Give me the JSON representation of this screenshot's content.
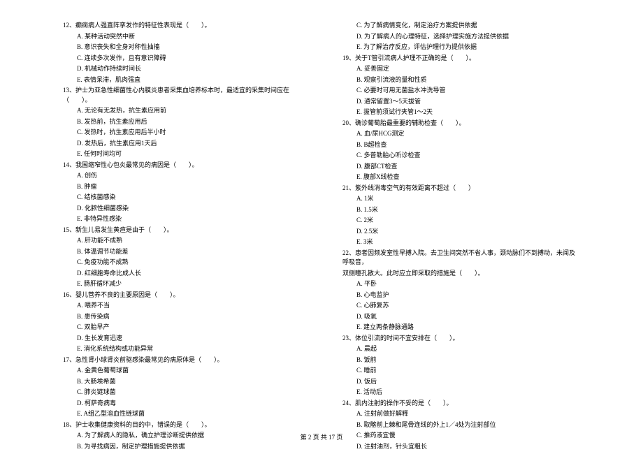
{
  "leftColumn": [
    {
      "type": "q",
      "text": "12、癫痫病人强直阵挛发作的特征性表现是（　　）。"
    },
    {
      "type": "o",
      "text": "A. 某种活动突然中断"
    },
    {
      "type": "o",
      "text": "B. 意识丧失和全身对称性抽搐"
    },
    {
      "type": "o",
      "text": "C. 连续多次发作，且有意识障碍"
    },
    {
      "type": "o",
      "text": "D. 机械动作持续时间长"
    },
    {
      "type": "o",
      "text": "E. 表情呆滞，肌肉强直"
    },
    {
      "type": "q",
      "text": "13、护士为亚急性细菌性心内膜炎患者采集血培养标本时，最适宜的采集时间应在（　　）。"
    },
    {
      "type": "o",
      "text": "A. 无论有无发热，抗生素应用前"
    },
    {
      "type": "o",
      "text": "B. 发热前，抗生素应用后"
    },
    {
      "type": "o",
      "text": "C. 发热时，抗生素应用后半小时"
    },
    {
      "type": "o",
      "text": "D. 发热后，抗生素应用1天后"
    },
    {
      "type": "o",
      "text": "E. 任何时间均可"
    },
    {
      "type": "q",
      "text": "14、我国缩窄性心包炎最常见的病因是（　　）。"
    },
    {
      "type": "o",
      "text": "A. 创伤"
    },
    {
      "type": "o",
      "text": "B. 肿瘤"
    },
    {
      "type": "o",
      "text": "C. 结核菌感染"
    },
    {
      "type": "o",
      "text": "D. 化脓性细菌感染"
    },
    {
      "type": "o",
      "text": "E. 非特异性感染"
    },
    {
      "type": "q",
      "text": "15、新生儿易发生黄疸是由于（　　）。"
    },
    {
      "type": "o",
      "text": "A. 肝功能不成熟"
    },
    {
      "type": "o",
      "text": "B. 体温调节功能差"
    },
    {
      "type": "o",
      "text": "C. 免疫功能不成熟"
    },
    {
      "type": "o",
      "text": "D. 红细胞寿命比成人长"
    },
    {
      "type": "o",
      "text": "E. 肠肝循环减少"
    },
    {
      "type": "q",
      "text": "16、婴儿营养不良的主要原因是（　　）。"
    },
    {
      "type": "o",
      "text": "A. 喂养不当"
    },
    {
      "type": "o",
      "text": "B. 患传染病"
    },
    {
      "type": "o",
      "text": "C. 双胎早产"
    },
    {
      "type": "o",
      "text": "D. 生长发育迅速"
    },
    {
      "type": "o",
      "text": "E. 消化系统结构或功能异常"
    },
    {
      "type": "q",
      "text": "17、急性肾小球肾炎前驱感染最常见的病原体是（　　）。"
    },
    {
      "type": "o",
      "text": "A. 金黄色葡萄球菌"
    },
    {
      "type": "o",
      "text": "B. 大肠埃希菌"
    },
    {
      "type": "o",
      "text": "C. 肺炎链球菌"
    },
    {
      "type": "o",
      "text": "D. 柯萨奇病毒"
    },
    {
      "type": "o",
      "text": "E. A组乙型溶血性链球菌"
    },
    {
      "type": "q",
      "text": "18、护士收集健康资料的目的中，错误的是（　　）。"
    },
    {
      "type": "o",
      "text": "A. 为了解病人的隐私，确立护理诊断提供依据"
    },
    {
      "type": "o",
      "text": "B. 为寻找病因，制定护理措施提供依据"
    }
  ],
  "rightColumn": [
    {
      "type": "o",
      "text": "C. 为了解病情变化，制定治疗方案提供依据"
    },
    {
      "type": "o",
      "text": "D. 为了解病人的心理特征，选择护理实施方法提供依据"
    },
    {
      "type": "o",
      "text": "E. 为了解治疗反应，评估护理行为提供依据"
    },
    {
      "type": "q",
      "text": "19、关于T管引流病人护理不正确的是（　　）。"
    },
    {
      "type": "o",
      "text": "A. 妥善固定"
    },
    {
      "type": "o",
      "text": "B. 观察引流液的量和性质"
    },
    {
      "type": "o",
      "text": "C. 必要时可用无菌盐水冲洗导管"
    },
    {
      "type": "o",
      "text": "D. 通常留置3～5天拔管"
    },
    {
      "type": "o",
      "text": "E. 拔管前须试行夹管1～2天"
    },
    {
      "type": "q",
      "text": "20、确诊葡萄胎最重要的辅助检查（　　）。"
    },
    {
      "type": "o",
      "text": "A. 血/尿HCG测定"
    },
    {
      "type": "o",
      "text": "B. B超检查"
    },
    {
      "type": "o",
      "text": "C. 多普勒胎心听诊检查"
    },
    {
      "type": "o",
      "text": "D. 腹部CT检查"
    },
    {
      "type": "o",
      "text": "E. 腹部X线检查"
    },
    {
      "type": "q",
      "text": "21、紫外线消毒空气的有效距离不超过（　　）"
    },
    {
      "type": "o",
      "text": "A. 1米"
    },
    {
      "type": "o",
      "text": "B. 1.5米"
    },
    {
      "type": "o",
      "text": "C. 2米"
    },
    {
      "type": "o",
      "text": "D. 2.5米"
    },
    {
      "type": "o",
      "text": "E. 3米"
    },
    {
      "type": "q",
      "text": "22、患者因频发室性早搏入院。去卫生间突然不省人事，颈动脉们不到搏动，未闻及呼吸音，"
    },
    {
      "type": "s",
      "text": "双侧瞳孔散大。此时应立即采取的措施是（　　）。"
    },
    {
      "type": "o",
      "text": "A. 平卧"
    },
    {
      "type": "o",
      "text": "B. 心电监护"
    },
    {
      "type": "o",
      "text": "C. 心肺复苏"
    },
    {
      "type": "o",
      "text": "D. 吸氧"
    },
    {
      "type": "o",
      "text": "E. 建立两条静脉通路"
    },
    {
      "type": "q",
      "text": "23、体位引流的时间不宜安排在（　　）。"
    },
    {
      "type": "o",
      "text": "A. 晨起"
    },
    {
      "type": "o",
      "text": "B. 饭前"
    },
    {
      "type": "o",
      "text": "C. 睡前"
    },
    {
      "type": "o",
      "text": "D. 饭后"
    },
    {
      "type": "o",
      "text": "E. 活动后"
    },
    {
      "type": "q",
      "text": "24、肌内注射的操作不妥的是（　　）。"
    },
    {
      "type": "o",
      "text": "A. 注射前做好解释"
    },
    {
      "type": "o",
      "text": "B. 取髂前上棘和尾骨连线的外上1／4处为注射部位"
    },
    {
      "type": "o",
      "text": "C. 推药液宜慢"
    },
    {
      "type": "o",
      "text": "D. 注射油剂，针头宜粗长"
    }
  ],
  "footer": "第 2 页 共 17 页"
}
